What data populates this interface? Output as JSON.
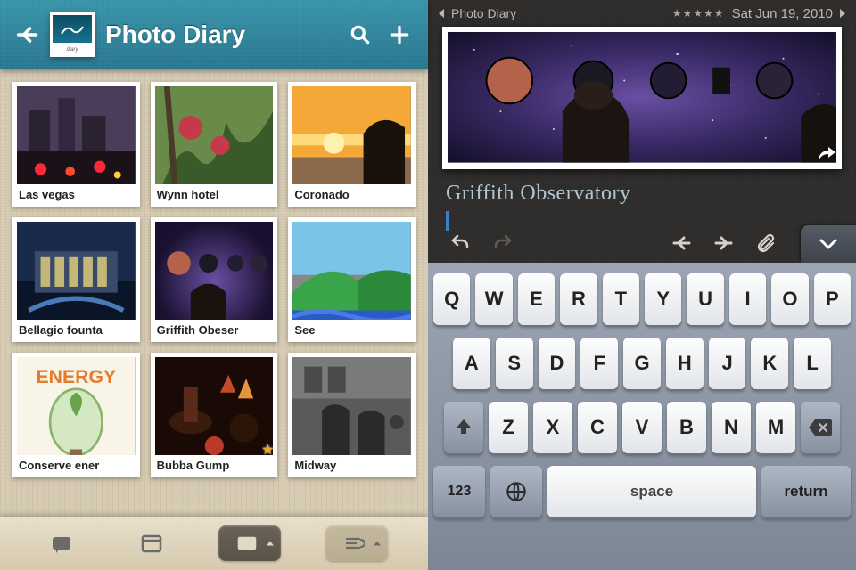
{
  "left": {
    "title": "Photo Diary",
    "thumbnails": [
      {
        "label": "Las vegas",
        "starred": false
      },
      {
        "label": "Wynn hotel",
        "starred": false
      },
      {
        "label": "Coronado",
        "starred": false
      },
      {
        "label": "Bellagio founta",
        "starred": false
      },
      {
        "label": "Griffith Obeser",
        "starred": false
      },
      {
        "label": "See",
        "starred": false
      },
      {
        "label": "Conserve ener",
        "starred": false
      },
      {
        "label": "Bubba Gump",
        "starred": true
      },
      {
        "label": "Midway",
        "starred": false
      }
    ],
    "toolbar": {
      "notes_icon": "note-icon",
      "calendar_icon": "calendar-icon",
      "view_icon": "view-mode-icon",
      "sort_icon": "sort-icon"
    }
  },
  "right": {
    "breadcrumb": "Photo Diary",
    "rating_fill": 5,
    "date": "Sat Jun 19, 2010",
    "title": "Griffith Observatory",
    "tools": {
      "undo": "undo-icon",
      "redo": "redo-icon",
      "prev": "arrow-left-icon",
      "next": "arrow-right-icon",
      "attach": "paperclip-icon",
      "collapse": "chevron-down-icon"
    }
  },
  "keyboard": {
    "row1": [
      "Q",
      "W",
      "E",
      "R",
      "T",
      "Y",
      "U",
      "I",
      "O",
      "P"
    ],
    "row2": [
      "A",
      "S",
      "D",
      "F",
      "G",
      "H",
      "J",
      "K",
      "L"
    ],
    "row3": [
      "Z",
      "X",
      "C",
      "V",
      "B",
      "N",
      "M"
    ],
    "mode_key": "123",
    "space_label": "space",
    "return_label": "return"
  }
}
